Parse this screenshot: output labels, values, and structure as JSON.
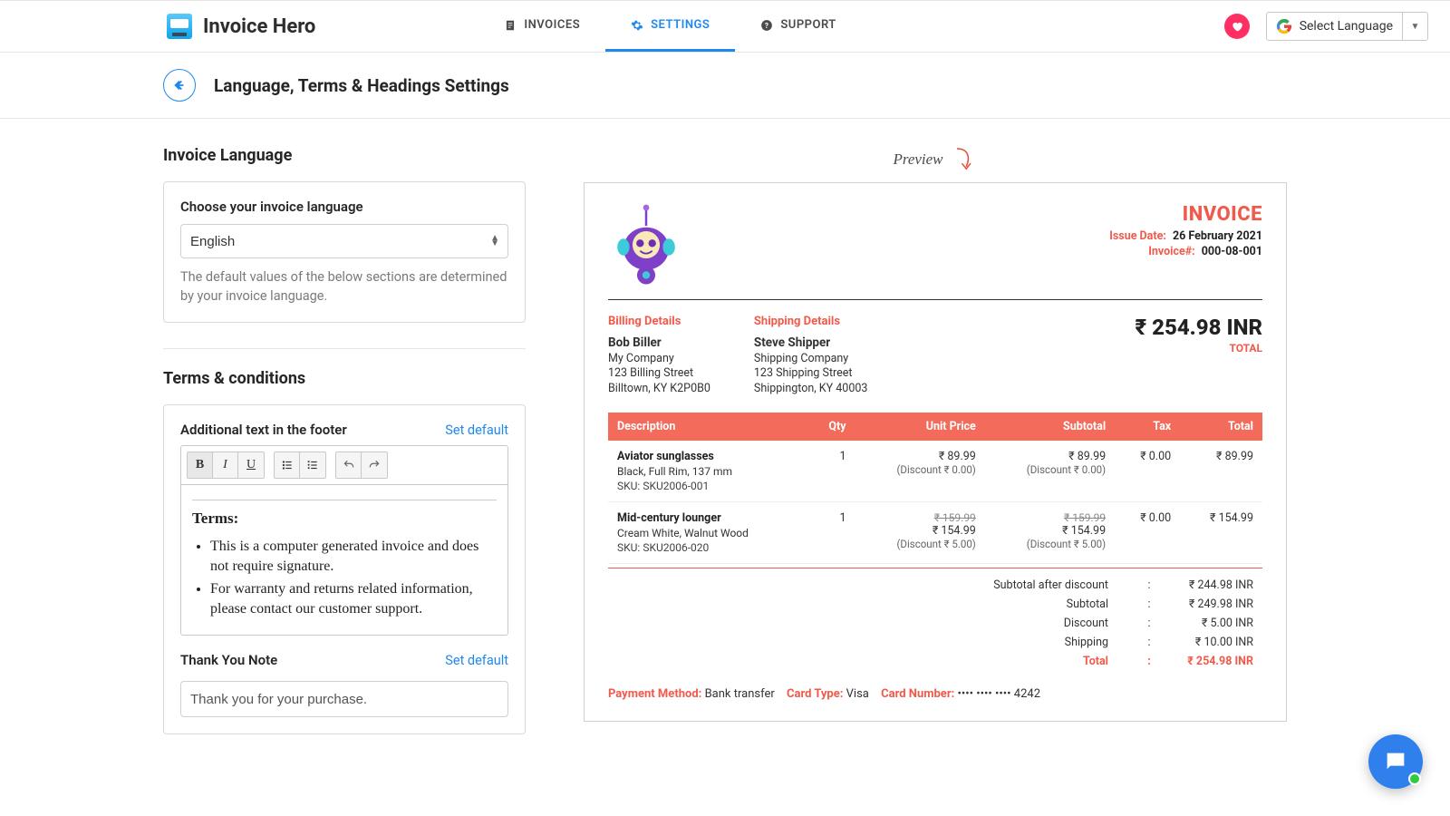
{
  "brand": "Invoice Hero",
  "nav": {
    "invoices": "INVOICES",
    "settings": "SETTINGS",
    "support": "SUPPORT"
  },
  "langSelector": "Select Language",
  "pageTitle": "Language, Terms & Headings Settings",
  "left": {
    "invoiceLanguageTitle": "Invoice Language",
    "chooseLabel": "Choose your invoice language",
    "languageValue": "English",
    "languageHelp": "The default values of the below sections are determined by your invoice language.",
    "termsTitle": "Terms & conditions",
    "footerLabel": "Additional text in the footer",
    "setDefault": "Set default",
    "termsHeading": "Terms:",
    "termsItem1": "This is a computer generated invoice and does not require signature.",
    "termsItem2": "For warranty and returns related information, please contact our customer support.",
    "thankYouLabel": "Thank You Note",
    "thankYouValue": "Thank you for your purchase."
  },
  "preview": {
    "label": "Preview",
    "heading": "INVOICE",
    "issueDateLabel": "Issue Date:",
    "issueDate": "26 February 2021",
    "invoiceNumLabel": "Invoice#:",
    "invoiceNum": "000-08-001",
    "billingTitle": "Billing Details",
    "billingName": "Bob Biller",
    "billingCompany": "My Company",
    "billingStreet": "123 Billing Street",
    "billingCity": "Billtown, KY K2P0B0",
    "shippingTitle": "Shipping Details",
    "shippingName": "Steve Shipper",
    "shippingCompany": "Shipping Company",
    "shippingStreet": "123 Shipping Street",
    "shippingCity": "Shippington, KY 40003",
    "grandTotal": "₹ 254.98 INR",
    "totalCap": "TOTAL",
    "cols": {
      "desc": "Description",
      "qty": "Qty",
      "unit": "Unit Price",
      "subtotal": "Subtotal",
      "tax": "Tax",
      "total": "Total"
    },
    "row1": {
      "name": "Aviator sunglasses",
      "sub": "Black, Full Rim, 137 mm",
      "sku": "SKU: SKU2006-001",
      "qty": "1",
      "unit": "₹ 89.99",
      "unitDisc": "(Discount ₹ 0.00)",
      "subtotal": "₹ 89.99",
      "subDisc": "(Discount ₹ 0.00)",
      "tax": "₹ 0.00",
      "total": "₹ 89.99"
    },
    "row2": {
      "name": "Mid-century lounger",
      "sub": "Cream White, Walnut Wood",
      "sku": "SKU: SKU2006-020",
      "qty": "1",
      "unitOld": "₹ 159.99",
      "unit": "₹ 154.99",
      "unitDisc": "(Discount ₹ 5.00)",
      "subOld": "₹ 159.99",
      "subtotal": "₹ 154.99",
      "subDisc": "(Discount ₹ 5.00)",
      "tax": "₹ 0.00",
      "total": "₹ 154.99"
    },
    "sum": {
      "afterDisc": "Subtotal after discount",
      "afterDiscVal": "₹ 244.98 INR",
      "subtotal": "Subtotal",
      "subtotalVal": "₹ 249.98 INR",
      "discount": "Discount",
      "discountVal": "₹ 5.00 INR",
      "shipping": "Shipping",
      "shippingVal": "₹ 10.00 INR",
      "total": "Total",
      "totalVal": "₹ 254.98 INR"
    },
    "pay": {
      "methodLbl": "Payment Method:",
      "method": "Bank transfer",
      "cardTypeLbl": "Card Type:",
      "cardType": "Visa",
      "cardNumLbl": "Card Number:",
      "cardNum": "•••• •••• •••• 4242"
    }
  }
}
